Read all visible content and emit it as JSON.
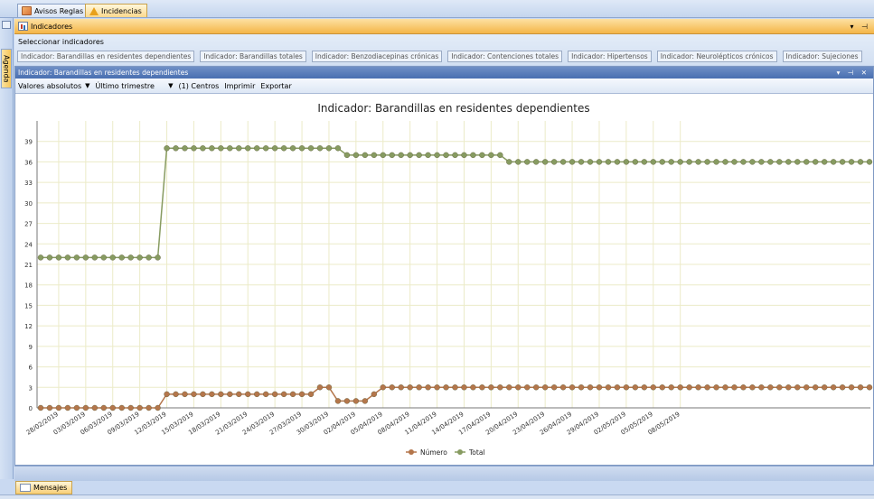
{
  "top_tabs": [
    {
      "label": "Avisos Reglas",
      "icon": "rules-icon",
      "active": false
    },
    {
      "label": "Incidencias",
      "icon": "warning-icon",
      "active": true
    }
  ],
  "side": {
    "agenda_label": "Agenda"
  },
  "indicators_panel": {
    "title": "Indicadores",
    "controls": "▾ ⊣",
    "select_label": "Seleccionar indicadores",
    "chips": [
      "Indicador: Barandillas en residentes dependientes",
      "Indicador: Barandillas totales",
      "Indicador: Benzodiacepinas crónicas",
      "Indicador: Contenciones totales",
      "Indicador: Hipertensos",
      "Indicador: Neurolépticos crónicos",
      "Indicador: Sujeciones"
    ]
  },
  "chart_window": {
    "title": "Indicador: Barandillas en residentes dependientes",
    "controls": "▾ ⊣ ✕",
    "toolbar": {
      "values_select": "Valores absolutos",
      "period_select": "Último trimestre",
      "centers_button": "(1) Centros",
      "print_button": "Imprimir",
      "export_button": "Exportar"
    }
  },
  "bottom": {
    "messages_tab": "Mensajes"
  },
  "colors": {
    "numero": "#b4764b",
    "total": "#879b61",
    "grid": "#ecebc8",
    "accent": "#f4b547"
  },
  "chart_data": {
    "type": "line",
    "title": "Indicador: Barandillas en residentes dependientes",
    "xlabel": "",
    "ylabel": "",
    "ylim": [
      0,
      42
    ],
    "yticks": [
      0,
      3,
      6,
      9,
      12,
      15,
      18,
      21,
      24,
      27,
      30,
      33,
      36,
      39
    ],
    "grid": true,
    "legend_position": "bottom",
    "start": "2019-02-26",
    "x_tick_labels": [
      "28/02/2019",
      "03/03/2019",
      "06/03/2019",
      "09/03/2019",
      "12/03/2019",
      "15/03/2019",
      "18/03/2019",
      "21/03/2019",
      "24/03/2019",
      "27/03/2019",
      "30/03/2019",
      "02/04/2019",
      "05/04/2019",
      "08/04/2019",
      "11/04/2019",
      "14/04/2019",
      "17/04/2019",
      "20/04/2019",
      "23/04/2019",
      "26/04/2019",
      "29/04/2019",
      "02/05/2019",
      "05/05/2019",
      "08/05/2019"
    ],
    "series": [
      {
        "name": "Número",
        "values": [
          0,
          0,
          0,
          0,
          0,
          0,
          0,
          0,
          0,
          0,
          0,
          0,
          0,
          0,
          2,
          2,
          2,
          2,
          2,
          2,
          2,
          2,
          2,
          2,
          2,
          2,
          2,
          2,
          2,
          2,
          2,
          3,
          3,
          1,
          1,
          1,
          1,
          2,
          3,
          3,
          3,
          3,
          3,
          3,
          3,
          3,
          3,
          3,
          3,
          3,
          3,
          3,
          3,
          3,
          3,
          3,
          3,
          3,
          3,
          3,
          3,
          3,
          3,
          3,
          3,
          3,
          3,
          3,
          3,
          3,
          3,
          3,
          3,
          3,
          3,
          3,
          3,
          3,
          3,
          3,
          3,
          3,
          3,
          3,
          3,
          3,
          3,
          3,
          3,
          3,
          3,
          3,
          3
        ]
      },
      {
        "name": "Total",
        "values": [
          22,
          22,
          22,
          22,
          22,
          22,
          22,
          22,
          22,
          22,
          22,
          22,
          22,
          22,
          38,
          38,
          38,
          38,
          38,
          38,
          38,
          38,
          38,
          38,
          38,
          38,
          38,
          38,
          38,
          38,
          38,
          38,
          38,
          38,
          37,
          37,
          37,
          37,
          37,
          37,
          37,
          37,
          37,
          37,
          37,
          37,
          37,
          37,
          37,
          37,
          37,
          37,
          36,
          36,
          36,
          36,
          36,
          36,
          36,
          36,
          36,
          36,
          36,
          36,
          36,
          36,
          36,
          36,
          36,
          36,
          36,
          36,
          36,
          36,
          36,
          36,
          36,
          36,
          36,
          36,
          36,
          36,
          36,
          36,
          36,
          36,
          36,
          36,
          36,
          36,
          36,
          36,
          36
        ]
      }
    ]
  }
}
